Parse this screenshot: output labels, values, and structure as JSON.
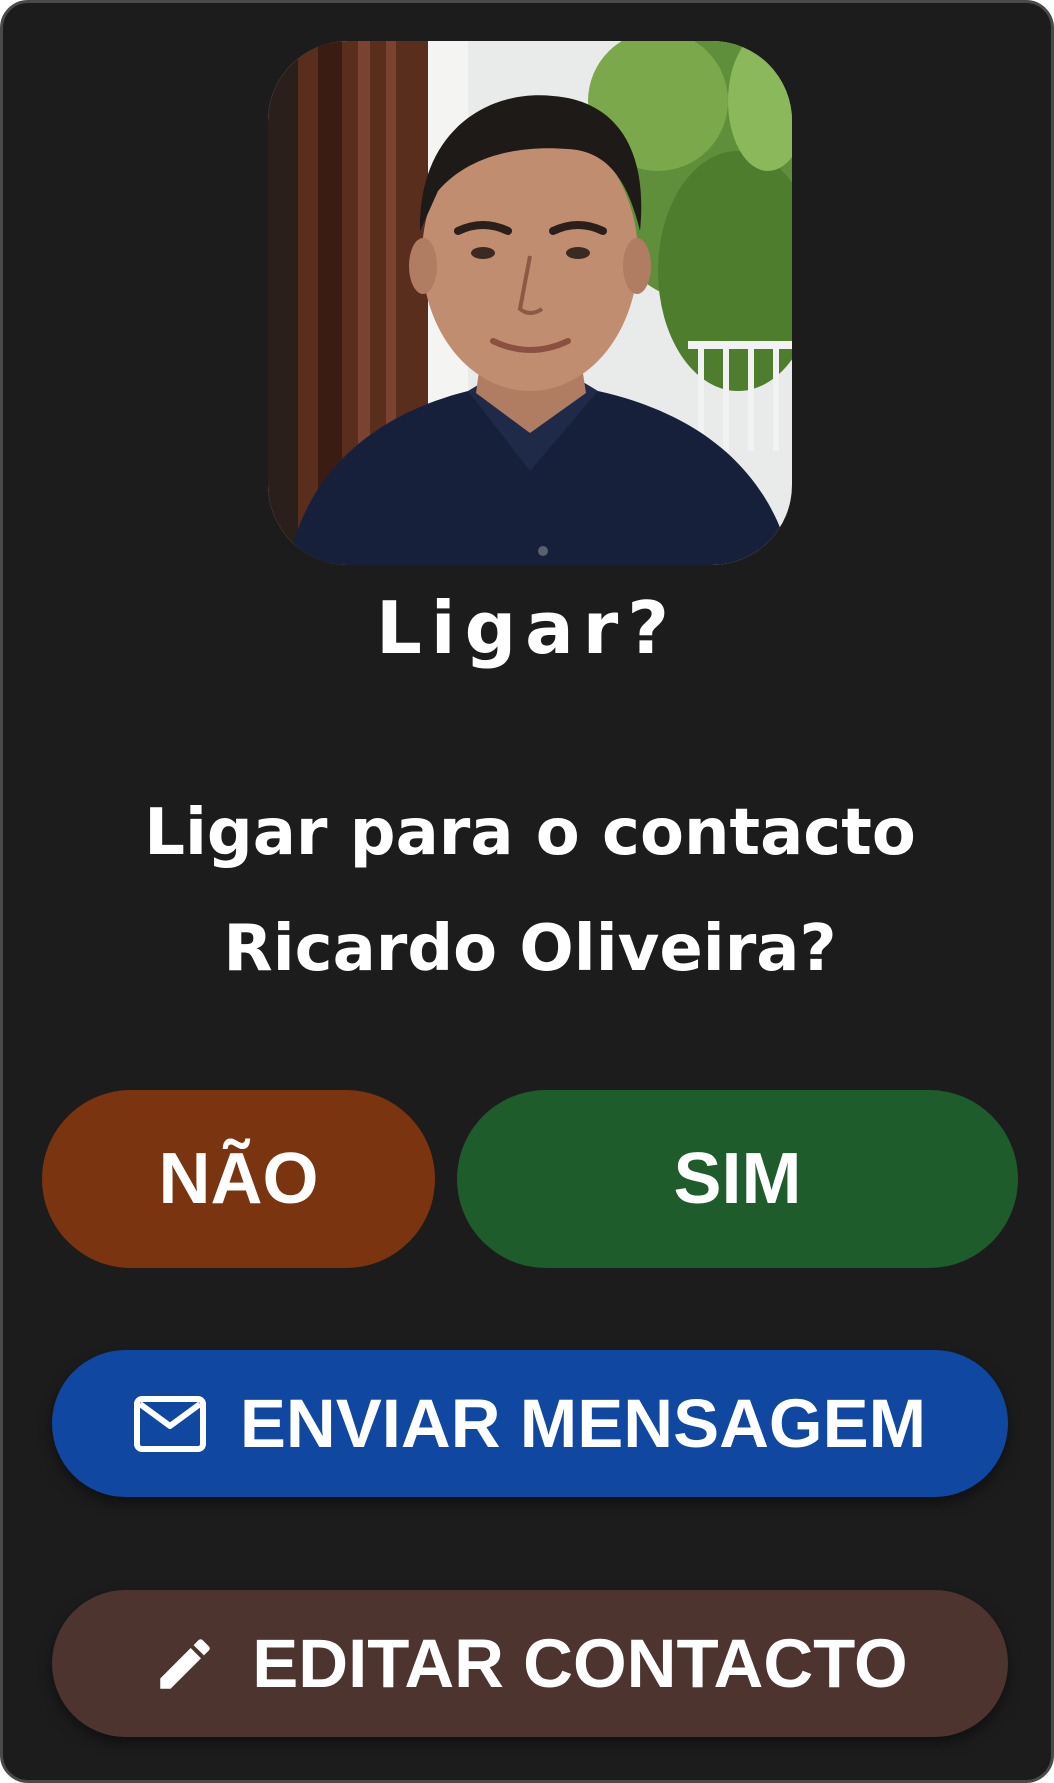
{
  "dialog": {
    "title": "Ligar?",
    "message": "Ligar para o contacto Ricardo Oliveira?",
    "contact_name": "Ricardo Oliveira"
  },
  "buttons": {
    "no_label": "NÃO",
    "yes_label": "SIM",
    "message_label": "ENVIAR MENSAGEM",
    "edit_label": "EDITAR CONTACTO"
  },
  "icons": {
    "message": "mail-icon",
    "edit": "pencil-icon"
  },
  "colors": {
    "background": "#1c1c1c",
    "no_button": "#7a3510",
    "yes_button": "#1f5c2b",
    "message_button": "#0f47a1",
    "edit_button": "#4e342e",
    "text": "#ffffff"
  }
}
